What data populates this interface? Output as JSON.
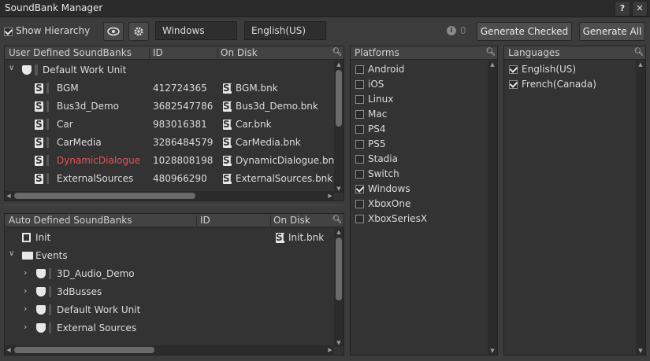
{
  "window": {
    "title": "SoundBank Manager"
  },
  "titlebar": {
    "help_label": "?",
    "close_label": "✕"
  },
  "toolbar": {
    "show_hierarchy_label": "Show Hierarchy",
    "platform_value": "Windows",
    "language_value": "English(US)",
    "info_count": "0",
    "generate_checked_label": "Generate Checked",
    "generate_all_label": "Generate All"
  },
  "user_banks": {
    "headers": {
      "name": "User Defined SoundBanks",
      "id": "ID",
      "disk": "On Disk"
    },
    "work_unit": "Default Work Unit",
    "rows": [
      {
        "name": "BGM",
        "id": "412724365",
        "file": "BGM.bnk",
        "status": "normal"
      },
      {
        "name": "Bus3d_Demo",
        "id": "3682547786",
        "file": "Bus3d_Demo.bnk",
        "status": "normal"
      },
      {
        "name": "Car",
        "id": "983016381",
        "file": "Car.bnk",
        "status": "normal"
      },
      {
        "name": "CarMedia",
        "id": "3286484579",
        "file": "CarMedia.bnk",
        "status": "normal"
      },
      {
        "name": "DynamicDialogue",
        "id": "1028808198",
        "file": "DynamicDialogue.bnk",
        "status": "error"
      },
      {
        "name": "ExternalSources",
        "id": "480966290",
        "file": "ExternalSources.bnk",
        "status": "normal"
      }
    ]
  },
  "auto_banks": {
    "headers": {
      "name": "Auto Defined SoundBanks",
      "id": "ID",
      "disk": "On Disk"
    },
    "init_name": "Init",
    "init_file": "Init.bnk",
    "events_label": "Events",
    "children": [
      "3D_Audio_Demo",
      "3dBusses",
      "Default Work Unit",
      "External Sources"
    ]
  },
  "platforms": {
    "header": "Platforms",
    "items": [
      {
        "label": "Android",
        "checked": false
      },
      {
        "label": "iOS",
        "checked": false
      },
      {
        "label": "Linux",
        "checked": false
      },
      {
        "label": "Mac",
        "checked": false
      },
      {
        "label": "PS4",
        "checked": false
      },
      {
        "label": "PS5",
        "checked": false
      },
      {
        "label": "Stadia",
        "checked": false
      },
      {
        "label": "Switch",
        "checked": false
      },
      {
        "label": "Windows",
        "checked": true
      },
      {
        "label": "XboxOne",
        "checked": false
      },
      {
        "label": "XboxSeriesX",
        "checked": false
      }
    ]
  },
  "languages": {
    "header": "Languages",
    "items": [
      {
        "label": "English(US)",
        "checked": true
      },
      {
        "label": "French(Canada)",
        "checked": true
      }
    ]
  }
}
